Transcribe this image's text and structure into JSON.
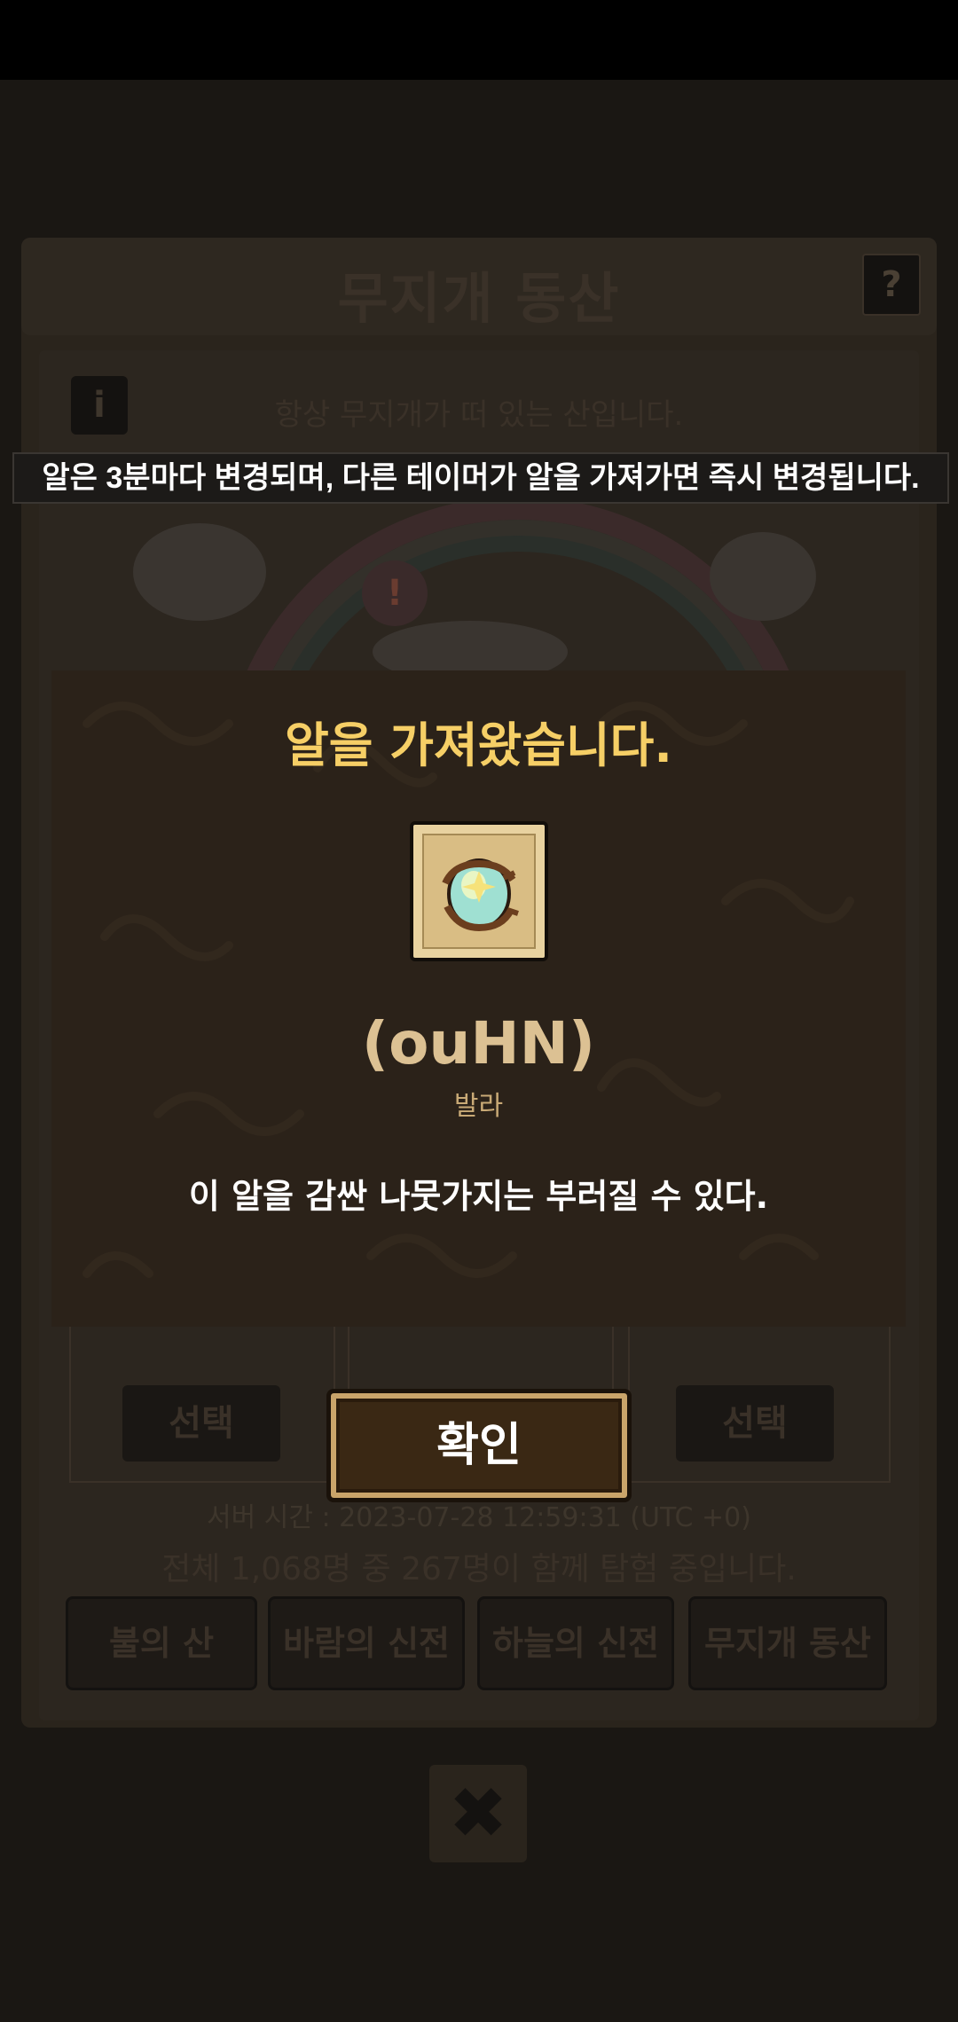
{
  "background": {
    "title": "무지개 동산",
    "help_icon": "?",
    "info_icon": "i",
    "subtitle": "항상 무지개가 떠 있는 산입니다.",
    "select_label": "선택",
    "server_time": "서버 시간 : 2023-07-28 12:59:31 (UTC +0)",
    "players_text": "전체 1,068명 중 267명이 함께 탐험 중입니다.",
    "tabs": [
      {
        "label": "불의 산"
      },
      {
        "label": "바람의 신전"
      },
      {
        "label": "하늘의 신전"
      },
      {
        "label": "무지개 동산"
      }
    ],
    "close_icon": "✖",
    "tip_badge": "!"
  },
  "notice": {
    "text": "알은 3분마다 변경되며, 다른 테이머가 알을 가져가면 즉시 변경됩니다."
  },
  "modal": {
    "title": "알을 가져왔습니다.",
    "egg_icon": "egg-icon",
    "egg_name": "(ouHN)",
    "egg_owner": "발라",
    "description": "이 알을 감싼 나뭇가지는 부러질 수 있다.",
    "confirm_label": "확인"
  },
  "colors": {
    "modal_bg": "#2b2219",
    "title_gold": "#f6cf66",
    "name_tan": "#dcc193"
  }
}
